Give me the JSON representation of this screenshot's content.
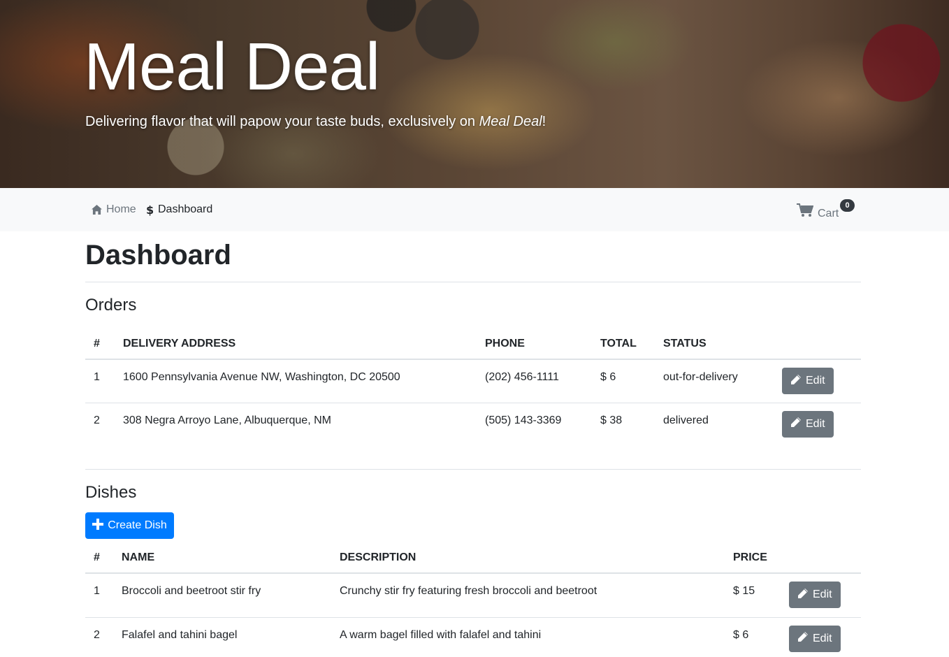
{
  "hero": {
    "title": "Meal Deal",
    "lead_prefix": "Delivering flavor that will papow your taste buds, exclusively on ",
    "lead_brand": "Meal Deal",
    "lead_suffix": "!"
  },
  "nav": {
    "home_label": "Home",
    "dashboard_label": "Dashboard",
    "cart_label": "Cart",
    "cart_count": "0"
  },
  "page": {
    "title": "Dashboard"
  },
  "orders": {
    "title": "Orders",
    "columns": [
      "#",
      "Delivery Address",
      "Phone",
      "Total",
      "Status"
    ],
    "rows": [
      {
        "num": "1",
        "address": "1600 Pennsylvania Avenue NW, Washington, DC 20500",
        "phone": "(202) 456-1111",
        "total": "$ 6",
        "status": "out-for-delivery"
      },
      {
        "num": "2",
        "address": "308 Negra Arroyo Lane, Albuquerque, NM",
        "phone": "(505) 143-3369",
        "total": "$ 38",
        "status": "delivered"
      }
    ],
    "edit_label": "Edit"
  },
  "dishes": {
    "title": "Dishes",
    "create_label": "Create Dish",
    "columns": [
      "#",
      "Name",
      "Description",
      "Price"
    ],
    "rows": [
      {
        "num": "1",
        "name": "Broccoli and beetroot stir fry",
        "description": "Crunchy stir fry featuring fresh broccoli and beetroot",
        "price": "$ 15"
      },
      {
        "num": "2",
        "name": "Falafel and tahini bagel",
        "description": "A warm bagel filled with falafel and tahini",
        "price": "$ 6"
      }
    ],
    "edit_label": "Edit"
  },
  "icons": {
    "home": "home-icon",
    "dashboard": "dollar-icon",
    "cart": "cart-icon",
    "edit": "pencil-icon",
    "create": "plus-icon"
  },
  "colors": {
    "primary": "#007bff",
    "secondary": "#6c757d",
    "navbar_bg": "#f8f9fa",
    "badge_bg": "#343a40"
  }
}
